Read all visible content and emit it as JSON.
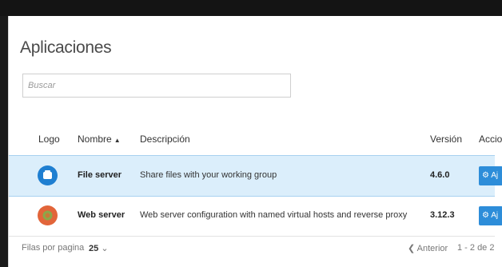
{
  "title": "Aplicaciones",
  "search": {
    "placeholder": "Buscar"
  },
  "table": {
    "headers": {
      "logo": "Logo",
      "name": "Nombre",
      "sort_indicator": "▲",
      "description": "Descripción",
      "version": "Versión",
      "actions": "Accio"
    },
    "rows": [
      {
        "name": "File server",
        "description": "Share files with your working group",
        "version": "4.6.0",
        "action_label": "⚙ Aj",
        "logo_icon": "file-server-logo-icon",
        "logo_color": "#1f7fd1",
        "selected": true
      },
      {
        "name": "Web server",
        "description": "Web server configuration with named virtual hosts and reverse proxy",
        "version": "3.12.3",
        "action_label": "⚙ Aj",
        "logo_icon": "web-server-logo-icon",
        "logo_color": "#e2653a",
        "selected": false
      }
    ]
  },
  "footer": {
    "rows_per_page_label": "Filas por pagina",
    "rows_per_page_value": "25",
    "dropdown_icon": "⌄",
    "prev_label": "❮ Anterior",
    "range": "1 - 2 de 2"
  },
  "colors": {
    "accent": "#2d8dd9",
    "selected_row": "#dbeefb"
  }
}
